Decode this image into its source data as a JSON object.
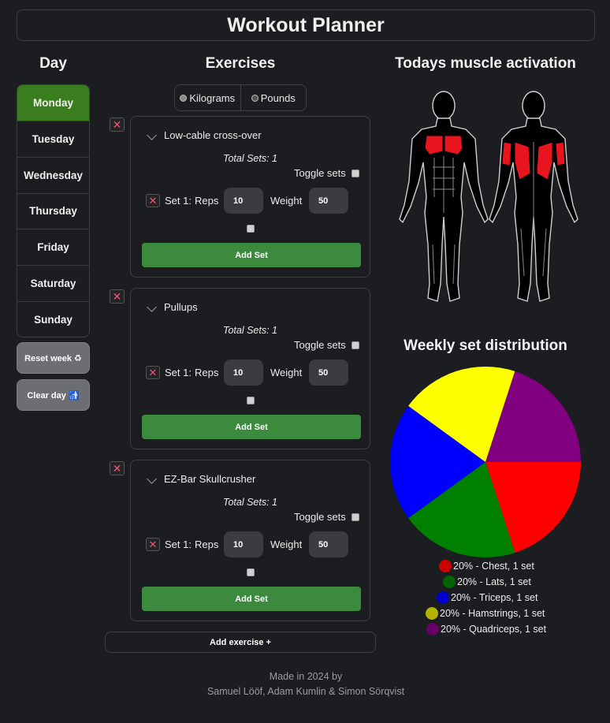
{
  "app": {
    "title": "Workout Planner"
  },
  "columns": {
    "day": "Day",
    "exercises": "Exercises",
    "activation": "Todays muscle activation",
    "distribution": "Weekly set distribution"
  },
  "days": [
    "Monday",
    "Tuesday",
    "Wednesday",
    "Thursday",
    "Friday",
    "Saturday",
    "Sunday"
  ],
  "active_day": "Monday",
  "buttons": {
    "reset_week": "Reset week ♻",
    "clear_day": "Clear day 🚮",
    "add_exercise": "Add exercise +",
    "add_set": "Add Set",
    "remove": "✕"
  },
  "units": {
    "kilograms": "Kilograms",
    "pounds": "Pounds",
    "selected": "Kilograms"
  },
  "labels": {
    "toggle_sets": "Toggle sets",
    "reps": "Reps",
    "weight": "Weight"
  },
  "exercises": [
    {
      "name": "Low-cable cross-over",
      "total": "Total Sets: 1",
      "set_label": "Set 1:",
      "reps": "10",
      "weight": "50"
    },
    {
      "name": "Pullups",
      "total": "Total Sets: 1",
      "set_label": "Set 1:",
      "reps": "10",
      "weight": "50"
    },
    {
      "name": "EZ-Bar Skullcrusher",
      "total": "Total Sets: 1",
      "set_label": "Set 1:",
      "reps": "10",
      "weight": "50"
    }
  ],
  "colors": {
    "active_day": "#3a7d1f",
    "add_set": "#3b8a3e",
    "activated_muscle": "#e8141e"
  },
  "chart_data": {
    "type": "pie",
    "title": "Weekly set distribution",
    "categories": [
      "Chest",
      "Lats",
      "Triceps",
      "Hamstrings",
      "Quadriceps"
    ],
    "values": [
      20,
      20,
      20,
      20,
      20
    ],
    "colors": [
      "#ff0000",
      "#008000",
      "#0000ff",
      "#ffff00",
      "#800080"
    ],
    "legend_colors": [
      "#cc0000",
      "#006400",
      "#0000cc",
      "#b3b300",
      "#660066"
    ],
    "legend": [
      "20% - Chest, 1 set",
      "20% - Lats, 1 set",
      "20% - Triceps, 1 set",
      "20% - Hamstrings, 1 set",
      "20% - Quadriceps, 1 set"
    ],
    "legend_placement": "bottom"
  },
  "footer": {
    "line1": "Made in 2024 by",
    "line2": "Samuel Lööf, Adam Kumlin & Simon Sörqvist"
  }
}
